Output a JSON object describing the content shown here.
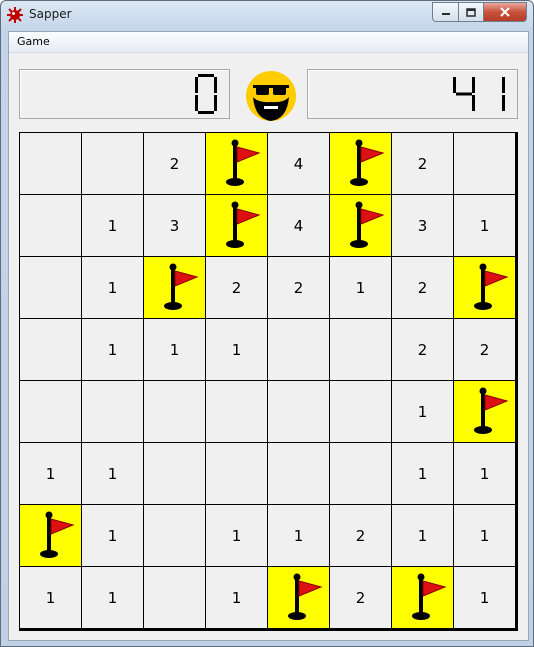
{
  "window": {
    "title": "Sapper"
  },
  "menu": {
    "game": "Game"
  },
  "mine_counter": "0",
  "timer": "41",
  "colors": {
    "flag_cell": "#ffff00",
    "flag": "#dd1111",
    "smiley": "#ffcc00"
  },
  "board": [
    [
      "",
      "",
      "2",
      "F",
      "4",
      "F",
      "2",
      ""
    ],
    [
      "",
      "1",
      "3",
      "F",
      "4",
      "F",
      "3",
      "1"
    ],
    [
      "",
      "1",
      "F",
      "2",
      "2",
      "1",
      "2",
      "F"
    ],
    [
      "",
      "1",
      "1",
      "1",
      "",
      "",
      "2",
      "2"
    ],
    [
      "",
      "",
      "",
      "",
      "",
      "",
      "1",
      "F"
    ],
    [
      "1",
      "1",
      "",
      "",
      "",
      "",
      "1",
      "1"
    ],
    [
      "F",
      "1",
      "",
      "1",
      "1",
      "2",
      "1",
      "1"
    ],
    [
      "1",
      "1",
      "",
      "1",
      "F",
      "2",
      "F",
      "1"
    ]
  ]
}
